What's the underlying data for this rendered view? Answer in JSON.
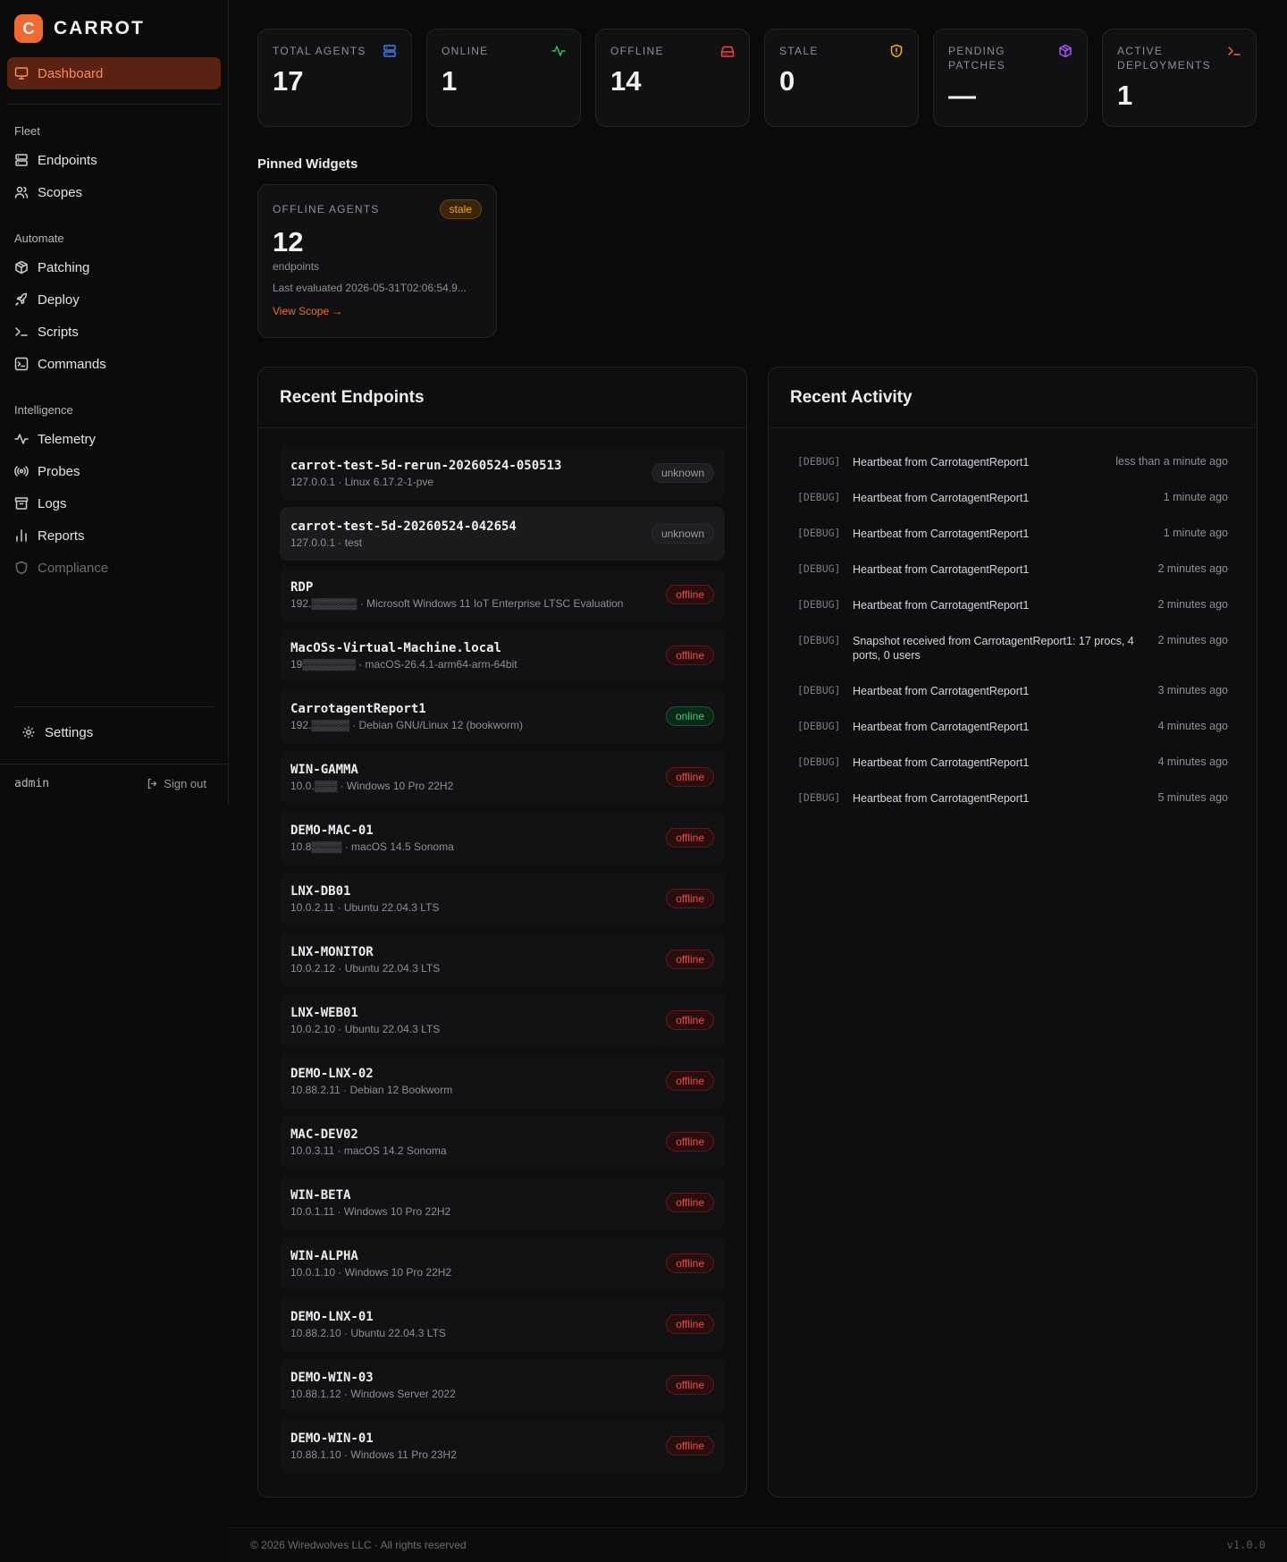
{
  "brand": {
    "logo_letter": "C",
    "name": "CARROT",
    "accent": "#f26a2e"
  },
  "sidebar": {
    "dashboard": "Dashboard",
    "sections": [
      {
        "title": "Fleet",
        "items": [
          {
            "label": "Endpoints",
            "icon": "server-icon"
          },
          {
            "label": "Scopes",
            "icon": "users-icon"
          }
        ]
      },
      {
        "title": "Automate",
        "items": [
          {
            "label": "Patching",
            "icon": "package-icon"
          },
          {
            "label": "Deploy",
            "icon": "rocket-icon"
          },
          {
            "label": "Scripts",
            "icon": "terminal-icon"
          },
          {
            "label": "Commands",
            "icon": "command-box-icon"
          }
        ]
      },
      {
        "title": "Intelligence",
        "items": [
          {
            "label": "Telemetry",
            "icon": "activity-icon"
          },
          {
            "label": "Probes",
            "icon": "radio-icon"
          },
          {
            "label": "Logs",
            "icon": "archive-icon"
          },
          {
            "label": "Reports",
            "icon": "bar-chart-icon"
          },
          {
            "label": "Compliance",
            "icon": "shield-icon"
          }
        ]
      }
    ],
    "settings": "Settings",
    "user": "admin",
    "sign_out": "Sign out"
  },
  "stats": [
    {
      "label": "TOTAL AGENTS",
      "value": "17",
      "icon": "server-icon",
      "color": "#3b82f6"
    },
    {
      "label": "ONLINE",
      "value": "1",
      "icon": "activity-icon",
      "color": "#22c55e"
    },
    {
      "label": "OFFLINE",
      "value": "14",
      "icon": "hard-drive-icon",
      "color": "#ef4444"
    },
    {
      "label": "STALE",
      "value": "0",
      "icon": "shield-alert-icon",
      "color": "#eab308"
    },
    {
      "label": "PENDING PATCHES",
      "value": "—",
      "icon": "package-icon",
      "color": "#a855f7"
    },
    {
      "label": "ACTIVE DEPLOYMENTS",
      "value": "1",
      "icon": "terminal-icon",
      "color": "#f26a2e"
    }
  ],
  "pinned": {
    "title": "Pinned Widgets",
    "card": {
      "label": "OFFLINE AGENTS",
      "badge": "stale",
      "count": "12",
      "unit": "endpoints",
      "evaluated": "Last evaluated 2026-05-31T02:06:54.9...",
      "link": "View Scope →"
    }
  },
  "endpoints": {
    "title": "Recent Endpoints",
    "rows": [
      {
        "name": "carrot-test-5d-rerun-20260524-050513",
        "meta": "127.0.0.1 · Linux 6.17.2-1-pve",
        "status": "unknown"
      },
      {
        "name": "carrot-test-5d-20260524-042654",
        "meta": "127.0.0.1 · test",
        "status": "unknown"
      },
      {
        "name": "RDP",
        "meta": "192.▒▒▒▒▒▒ · Microsoft Windows 11 IoT Enterprise LTSC Evaluation",
        "status": "offline"
      },
      {
        "name": "MacOSs-Virtual-Machine.local",
        "meta": "19▒▒▒▒▒▒▒ · macOS-26.4.1-arm64-arm-64bit",
        "status": "offline"
      },
      {
        "name": "CarrotagentReport1",
        "meta": "192.▒▒▒▒▒ · Debian GNU/Linux 12 (bookworm)",
        "status": "online"
      },
      {
        "name": "WIN-GAMMA",
        "meta": "10.0.▒▒▒ · Windows 10 Pro 22H2",
        "status": "offline"
      },
      {
        "name": "DEMO-MAC-01",
        "meta": "10.8▒▒▒▒ · macOS 14.5 Sonoma",
        "status": "offline"
      },
      {
        "name": "LNX-DB01",
        "meta": "10.0.2.11 · Ubuntu 22.04.3 LTS",
        "status": "offline"
      },
      {
        "name": "LNX-MONITOR",
        "meta": "10.0.2.12 · Ubuntu 22.04.3 LTS",
        "status": "offline"
      },
      {
        "name": "LNX-WEB01",
        "meta": "10.0.2.10 · Ubuntu 22.04.3 LTS",
        "status": "offline"
      },
      {
        "name": "DEMO-LNX-02",
        "meta": "10.88.2.11 · Debian 12 Bookworm",
        "status": "offline"
      },
      {
        "name": "MAC-DEV02",
        "meta": "10.0.3.11 · macOS 14.2 Sonoma",
        "status": "offline"
      },
      {
        "name": "WIN-BETA",
        "meta": "10.0.1.11 · Windows 10 Pro 22H2",
        "status": "offline"
      },
      {
        "name": "WIN-ALPHA",
        "meta": "10.0.1.10 · Windows 10 Pro 22H2",
        "status": "offline"
      },
      {
        "name": "DEMO-LNX-01",
        "meta": "10.88.2.10 · Ubuntu 22.04.3 LTS",
        "status": "offline"
      },
      {
        "name": "DEMO-WIN-03",
        "meta": "10.88.1.12 · Windows Server 2022",
        "status": "offline"
      },
      {
        "name": "DEMO-WIN-01",
        "meta": "10.88.1.10 · Windows 11 Pro 23H2",
        "status": "offline"
      }
    ]
  },
  "activity": {
    "title": "Recent Activity",
    "rows": [
      {
        "level": "[DEBUG]",
        "message": "Heartbeat from CarrotagentReport1",
        "time": "less than a minute ago"
      },
      {
        "level": "[DEBUG]",
        "message": "Heartbeat from CarrotagentReport1",
        "time": "1 minute ago"
      },
      {
        "level": "[DEBUG]",
        "message": "Heartbeat from CarrotagentReport1",
        "time": "1 minute ago"
      },
      {
        "level": "[DEBUG]",
        "message": "Heartbeat from CarrotagentReport1",
        "time": "2 minutes ago"
      },
      {
        "level": "[DEBUG]",
        "message": "Heartbeat from CarrotagentReport1",
        "time": "2 minutes ago"
      },
      {
        "level": "[DEBUG]",
        "message": "Snapshot received from CarrotagentReport1: 17 procs, 4 ports, 0 users",
        "time": "2 minutes ago"
      },
      {
        "level": "[DEBUG]",
        "message": "Heartbeat from CarrotagentReport1",
        "time": "3 minutes ago"
      },
      {
        "level": "[DEBUG]",
        "message": "Heartbeat from CarrotagentReport1",
        "time": "4 minutes ago"
      },
      {
        "level": "[DEBUG]",
        "message": "Heartbeat from CarrotagentReport1",
        "time": "4 minutes ago"
      },
      {
        "level": "[DEBUG]",
        "message": "Heartbeat from CarrotagentReport1",
        "time": "5 minutes ago"
      }
    ]
  },
  "footer": {
    "copyright": "© 2026 Wiredwolves LLC · All rights reserved",
    "version": "v1.0.0"
  }
}
